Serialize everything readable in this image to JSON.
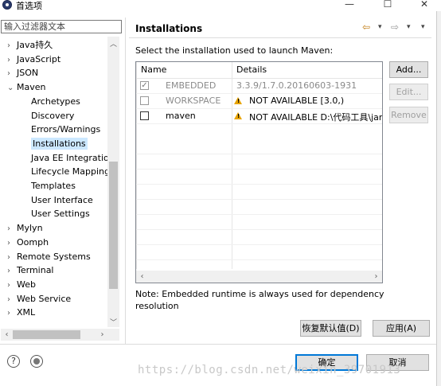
{
  "window": {
    "title": "首选项",
    "controls": {
      "minimize": "—",
      "maximize": "☐",
      "close": "✕"
    }
  },
  "filter": {
    "placeholder": "输入过滤器文本"
  },
  "tree": [
    {
      "label": "Java持久",
      "chev": "›",
      "indent": 0
    },
    {
      "label": "JavaScript",
      "chev": "›",
      "indent": 0
    },
    {
      "label": "JSON",
      "chev": "›",
      "indent": 0
    },
    {
      "label": "Maven",
      "chev": "⌄",
      "indent": 0
    },
    {
      "label": "Archetypes",
      "chev": "",
      "indent": 1
    },
    {
      "label": "Discovery",
      "chev": "",
      "indent": 1
    },
    {
      "label": "Errors/Warnings",
      "chev": "",
      "indent": 1
    },
    {
      "label": "Installations",
      "chev": "",
      "indent": 1,
      "selected": true
    },
    {
      "label": "Java EE Integration",
      "chev": "",
      "indent": 1
    },
    {
      "label": "Lifecycle Mapping",
      "chev": "",
      "indent": 1
    },
    {
      "label": "Templates",
      "chev": "",
      "indent": 1
    },
    {
      "label": "User Interface",
      "chev": "",
      "indent": 1
    },
    {
      "label": "User Settings",
      "chev": "",
      "indent": 1
    },
    {
      "label": "Mylyn",
      "chev": "›",
      "indent": 0
    },
    {
      "label": "Oomph",
      "chev": "›",
      "indent": 0
    },
    {
      "label": "Remote Systems",
      "chev": "›",
      "indent": 0
    },
    {
      "label": "Terminal",
      "chev": "›",
      "indent": 0
    },
    {
      "label": "Web",
      "chev": "›",
      "indent": 0
    },
    {
      "label": "Web Service",
      "chev": "›",
      "indent": 0
    },
    {
      "label": "XML",
      "chev": "›",
      "indent": 0
    }
  ],
  "page": {
    "title": "Installations",
    "nav": {
      "back": "⇦",
      "back_menu": "▾",
      "forward": "⇨",
      "forward_menu": "▾",
      "view_menu": "▾"
    },
    "instruction": "Select the installation used to launch Maven:",
    "columns": {
      "name": "Name",
      "details": "Details"
    },
    "installations": [
      {
        "checked": true,
        "check_glyph": "✓",
        "name": "EMBEDDED",
        "details": "3.3.9/1.7.0.20160603-1931",
        "gray": true,
        "warn": false
      },
      {
        "checked": false,
        "check_glyph": "",
        "name": "WORKSPACE",
        "details": "NOT AVAILABLE [3.0,)",
        "gray": true,
        "warn": true
      },
      {
        "checked": false,
        "check_glyph": "",
        "name": "maven",
        "details": "NOT AVAILABLE D:\\代码工具\\jar\\a",
        "gray": false,
        "warn": true
      }
    ],
    "buttons": {
      "add": "Add...",
      "edit": "Edit...",
      "remove": "Remove"
    },
    "note": "Note: Embedded runtime is always used for dependency resolution",
    "restore_defaults": "恢复默认值(D)",
    "apply": "应用(A)"
  },
  "footer": {
    "help": "?",
    "ok": "确定",
    "cancel": "取消"
  },
  "watermark": "https://blog.csdn.net/weixin_39701913",
  "colors": {
    "selection": "#cce8ff",
    "warning": "#e8a400",
    "primary_border": "#0078d7"
  }
}
